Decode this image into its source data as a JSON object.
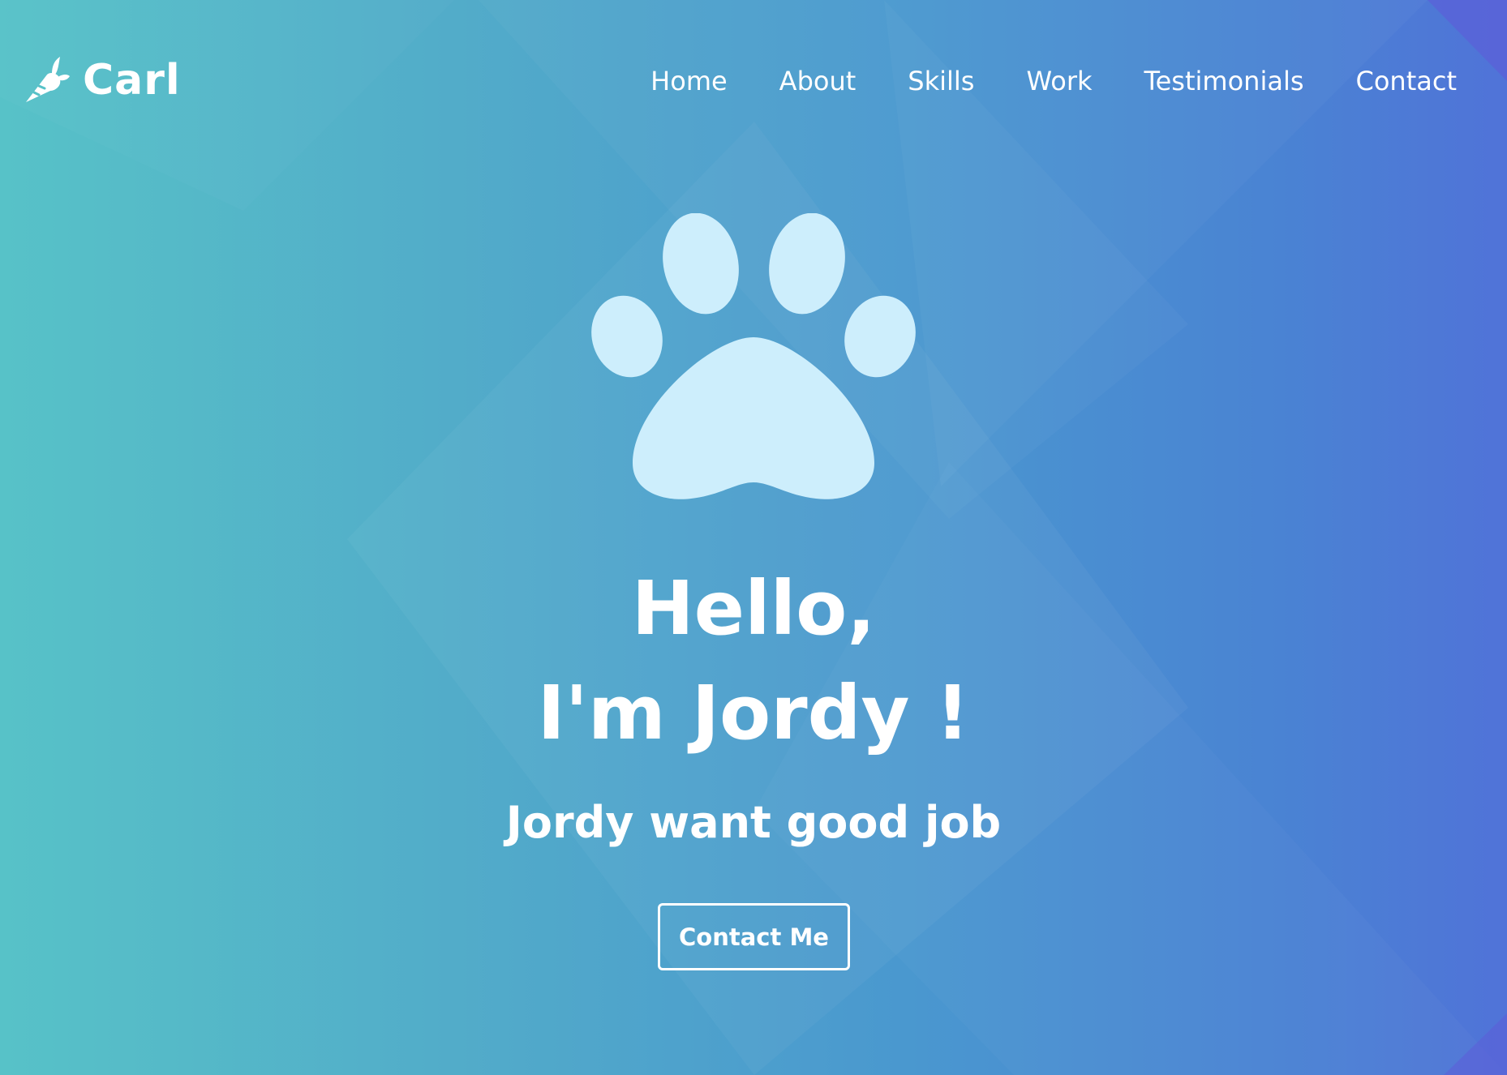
{
  "brand": {
    "name": "Carl",
    "icon": "carrot-icon"
  },
  "nav": {
    "items": [
      {
        "label": "Home"
      },
      {
        "label": "About"
      },
      {
        "label": "Skills"
      },
      {
        "label": "Work"
      },
      {
        "label": "Testimonials"
      },
      {
        "label": "Contact"
      }
    ]
  },
  "hero": {
    "icon": "paw-icon",
    "title_line1": "Hello,",
    "title_line2": "I'm Jordy !",
    "subtitle": "Jordy want good job",
    "cta_label": "Contact Me"
  },
  "colors": {
    "gradient_start": "#57c2c8",
    "gradient_end": "#5073d8",
    "paw": "#cdeefc",
    "text": "#ffffff"
  }
}
